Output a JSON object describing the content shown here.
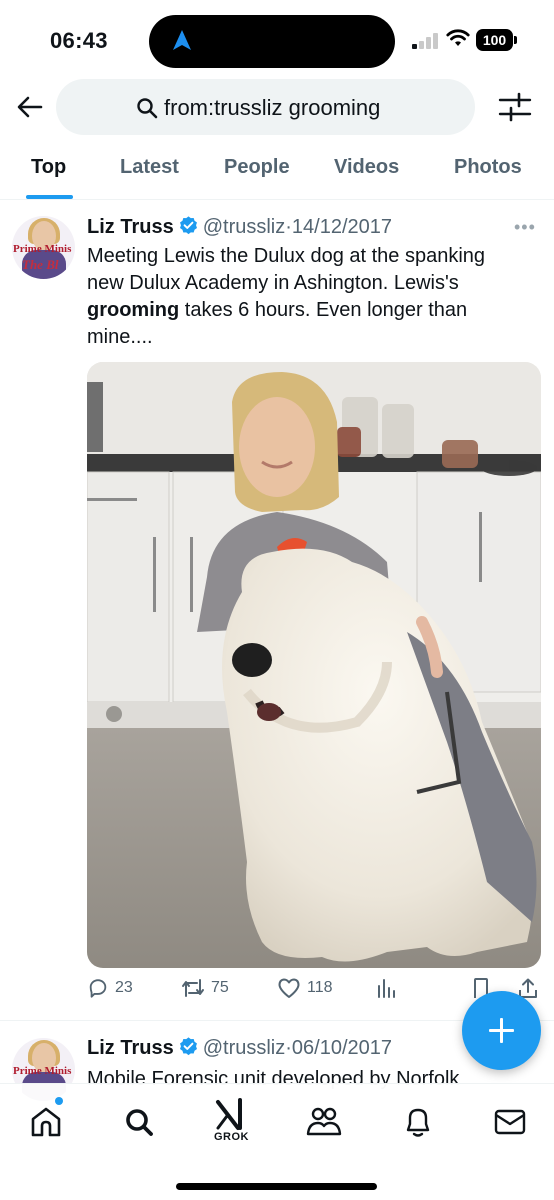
{
  "status_bar": {
    "time": "06:43",
    "battery": "100"
  },
  "search": {
    "query": "from:trussliz grooming"
  },
  "tabs": [
    {
      "label": "Top"
    },
    {
      "label": "Latest"
    },
    {
      "label": "People"
    },
    {
      "label": "Videos"
    },
    {
      "label": "Photos"
    }
  ],
  "tweets": [
    {
      "author": "Liz Truss",
      "handle": "@trussliz",
      "separator": "·",
      "date": "14/12/2017",
      "text_before": "Meeting Lewis the Dulux dog at the spanking new Dulux Academy in Ashington. Lewis's ",
      "text_bold": "grooming",
      "text_after": " takes 6 hours. Even longer than mine....",
      "replies": "23",
      "reposts": "75",
      "likes": "118",
      "avatar_text_1": "Prime Minis",
      "avatar_text_2": "The Bl"
    },
    {
      "author": "Liz Truss",
      "handle": "@trussliz",
      "separator": "·",
      "date": "06/10/2017",
      "text": "Mobile Forensic unit developed by Norfolk",
      "avatar_text_1": "Prime Minis"
    }
  ],
  "bottom_nav": {
    "grok_label": "GROK"
  },
  "colors": {
    "accent": "#1d9bf0",
    "text": "#0f1419",
    "secondary": "#536471",
    "search_bg": "#eff3f4"
  }
}
